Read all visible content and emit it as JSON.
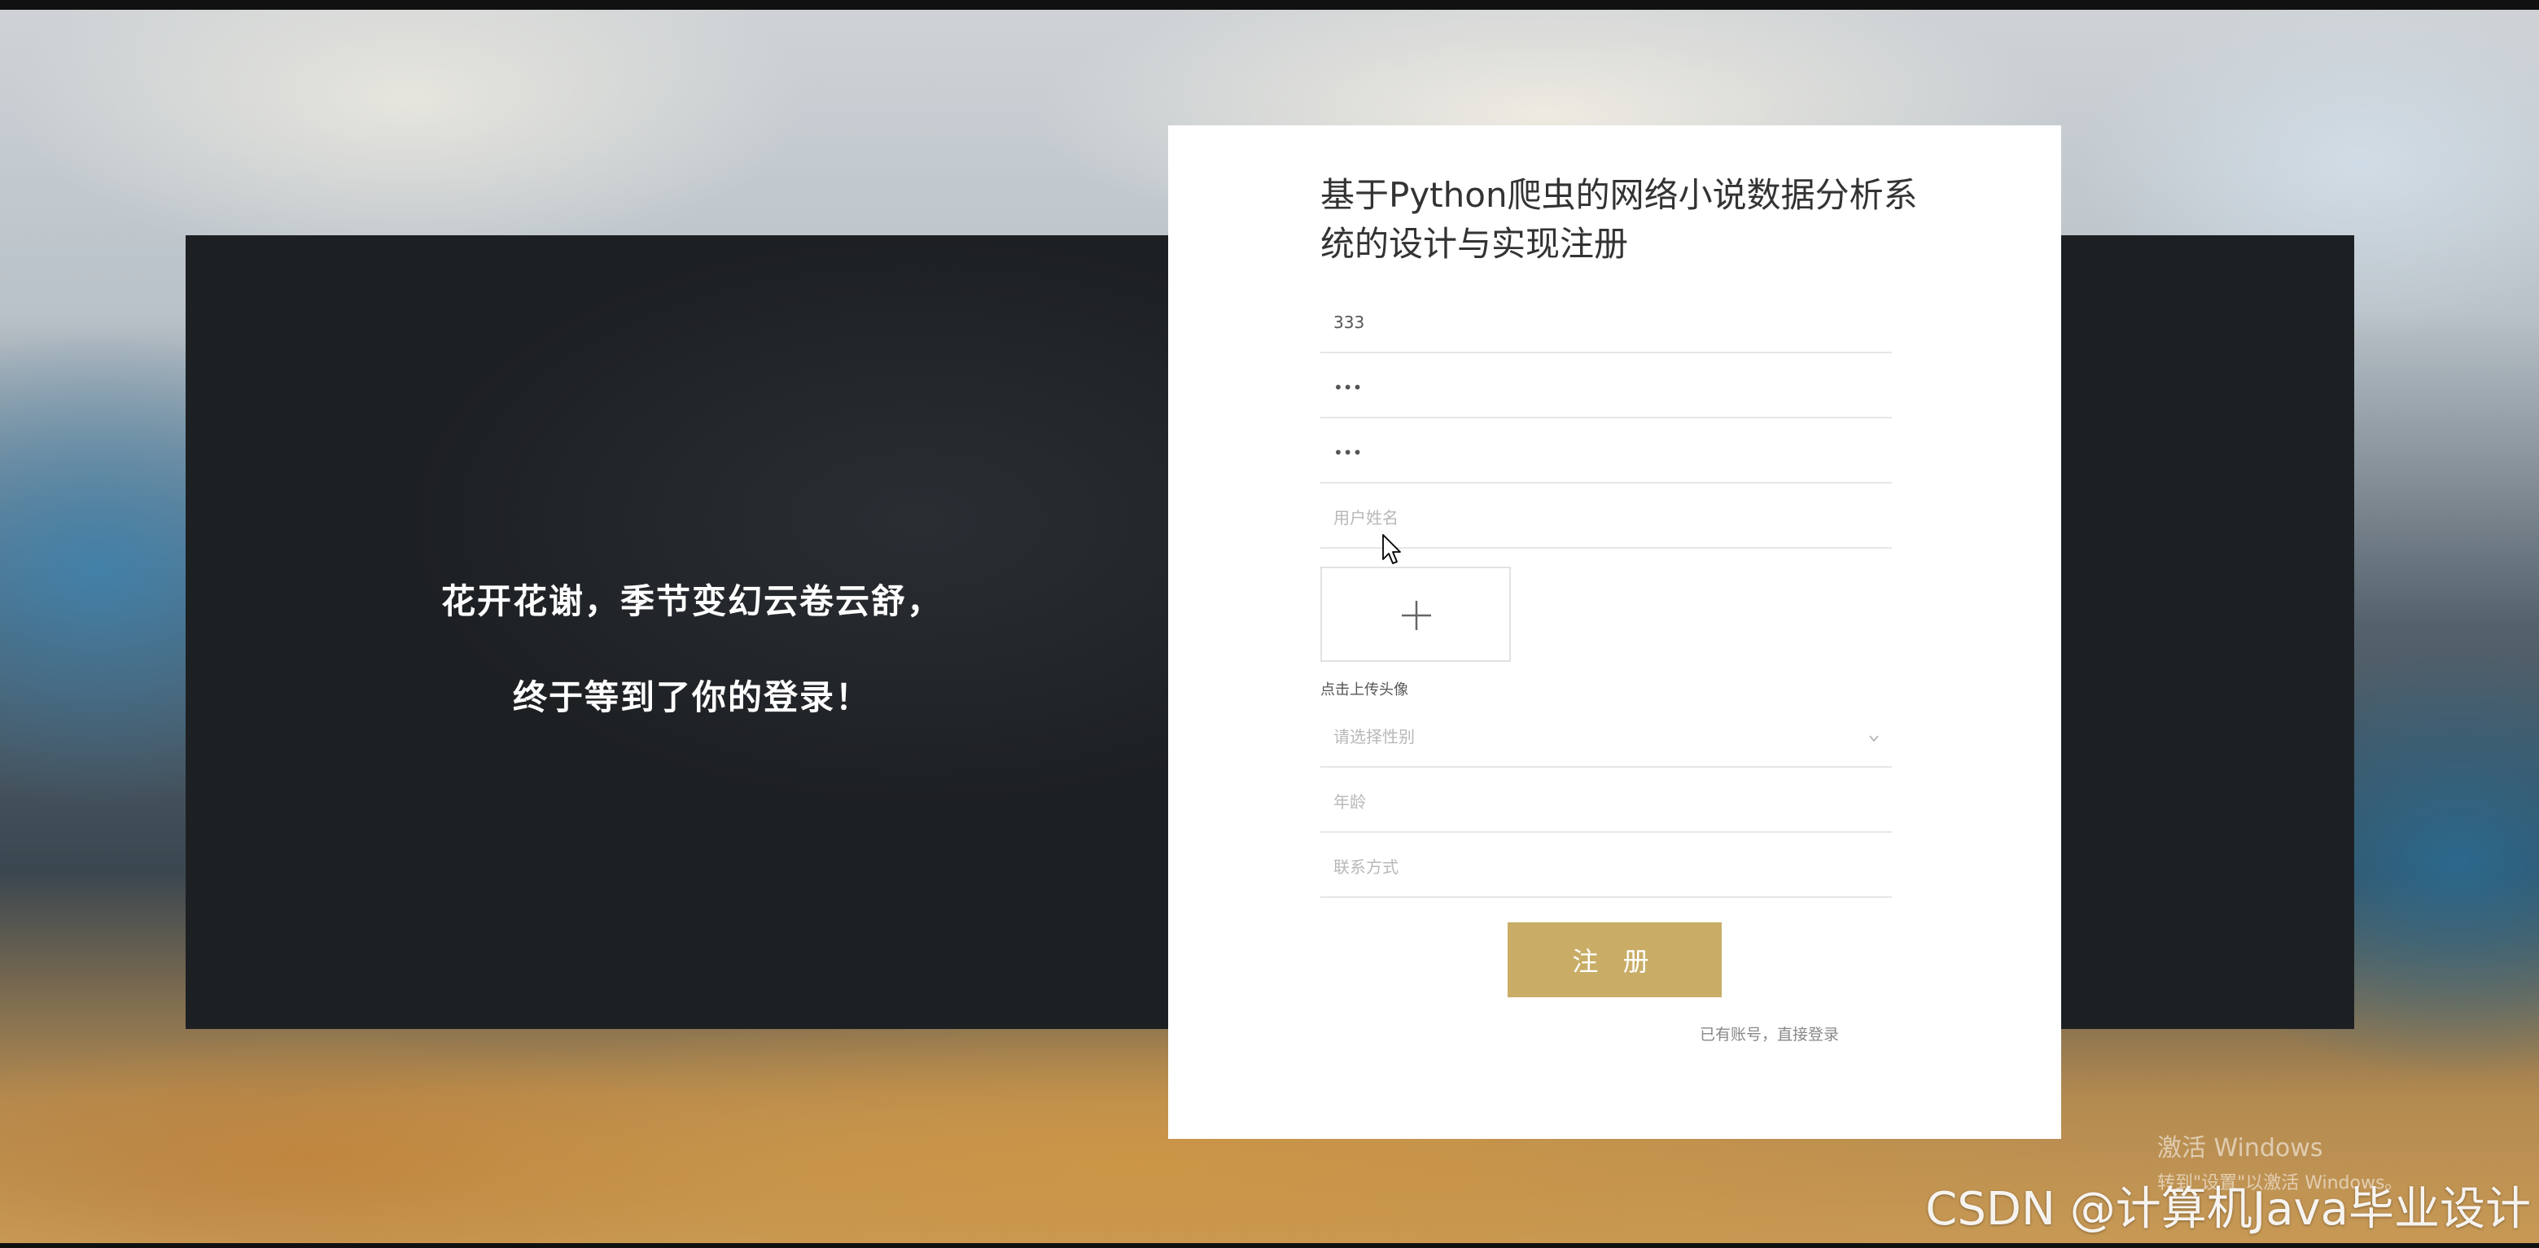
{
  "slogan": {
    "line1": "花开花谢，季节变幻云卷云舒，",
    "line2": "终于等到了你的登录！"
  },
  "form": {
    "title": "基于Python爬虫的网络小说数据分析系统的设计与实现注册",
    "account": {
      "value": "333"
    },
    "password": {
      "value": "•••"
    },
    "confirm_password": {
      "value": "•••"
    },
    "username": {
      "placeholder": "用户姓名"
    },
    "avatar_upload": {
      "label": "点击上传头像",
      "icon": "plus-icon"
    },
    "gender": {
      "placeholder": "请选择性别",
      "icon": "chevron-down-icon"
    },
    "age": {
      "placeholder": "年龄"
    },
    "contact": {
      "placeholder": "联系方式"
    },
    "submit_label": "注 册",
    "login_link": "已有账号，直接登录"
  },
  "overlay": {
    "windows_line1": "激活 Windows",
    "windows_line2": "转到\"设置\"以激活 Windows。",
    "csdn": "CSDN @计算机Java毕业设计"
  },
  "colors": {
    "accent": "#c9ad67",
    "panel": "#202326",
    "card": "#ffffff"
  }
}
